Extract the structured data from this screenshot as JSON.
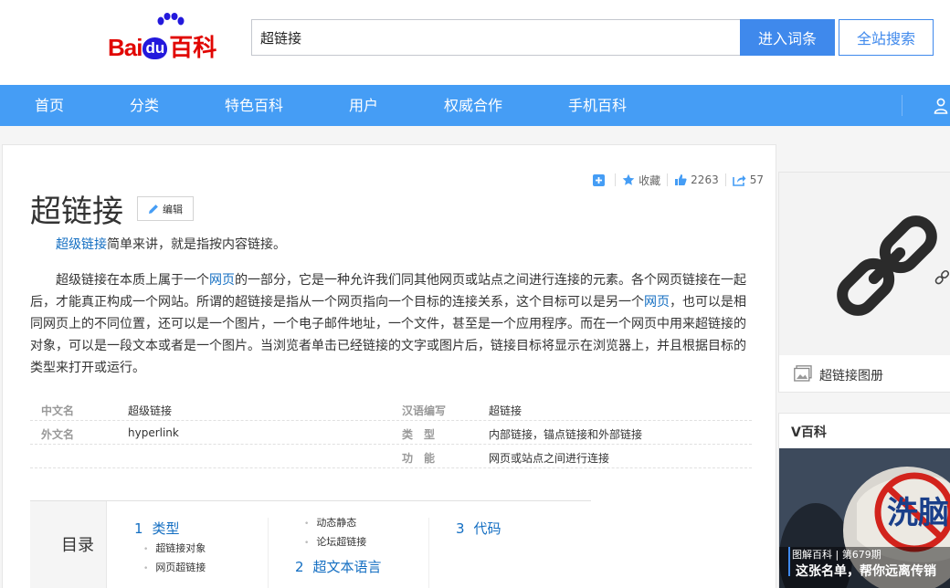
{
  "header": {
    "logo": {
      "bai": "Bai",
      "du": "du",
      "baike": "百科"
    },
    "search_value": "超链接",
    "enter_label": "进入词条",
    "site_search_label": "全站搜索"
  },
  "nav": {
    "items": [
      {
        "label": "首页"
      },
      {
        "label": "分类"
      },
      {
        "label": "特色百科"
      },
      {
        "label": "用户"
      },
      {
        "label": "权威合作"
      },
      {
        "label": "手机百科"
      }
    ]
  },
  "toolbar": {
    "collect_label": "收藏",
    "like_count": "2263",
    "share_count": "57"
  },
  "article": {
    "title": "超链接",
    "edit_label": "编辑",
    "para1_link": "超级链接",
    "para1_rest": "简单来讲，就是指按内容链接。",
    "para2": [
      {
        "t": "超级链接在本质上属于一个"
      },
      {
        "t": "网页",
        "link": true
      },
      {
        "t": "的一部分，它是一种允许我们同其他网页或站点之间进行连接的元素。各个网页链接在一起后，才能真正构成一个网站。所谓的超链接是指从一个网页指向一个目标的连接关系，这个目标可以是另一个"
      },
      {
        "t": "网页",
        "link": true
      },
      {
        "t": "，也可以是相同网页上的不同位置，还可以是一个图片，一个电子邮件地址，一个文件，甚至是一个应用程序。而在一个网页中用来超链接的对象，可以是一段文本或者是一个图片。当浏览者单击已经链接的文字或图片后，链接目标将显示在浏览器上，并且根据目标的类型来打开或运行。"
      }
    ]
  },
  "basic_info": {
    "rows": [
      {
        "left_name": "中文名",
        "left_value": "超级链接",
        "right_name": "汉语编写",
        "right_value": "超链接"
      },
      {
        "left_name": "外文名",
        "left_value": "hyperlink",
        "right_name": "类　型",
        "right_value": "内部链接，锚点链接和外部链接"
      },
      {
        "left_name": "",
        "left_value": "",
        "right_name": "功　能",
        "right_value": "网页或站点之间进行连接"
      }
    ]
  },
  "catalog": {
    "title": "目录",
    "l1": [
      {
        "num": "1",
        "label": "类型"
      },
      {
        "num": "2",
        "label": "超文本语言"
      },
      {
        "num": "3",
        "label": "代码"
      }
    ],
    "l2": [
      "超链接对象",
      "网页超链接",
      "动态静态",
      "论坛超链接"
    ]
  },
  "side": {
    "album_label": "超链接图册",
    "vbaike_title": "V百科",
    "vbaike_meta": "图解百科 | 第679期",
    "vbaike_caption": "这张名单，帮你远离传销",
    "vbaike_hat_text": "洗脑"
  },
  "colors": {
    "brand_red": "#e10602",
    "brand_blue": "#2319dc",
    "nav_blue": "#459df5",
    "button_blue": "#3f89ec",
    "link_blue": "#136ec2"
  }
}
